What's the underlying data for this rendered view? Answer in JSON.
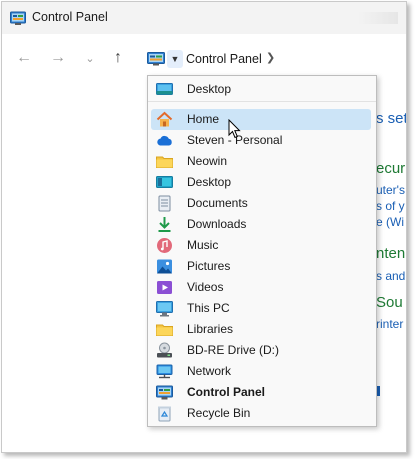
{
  "window": {
    "title": "Control Panel"
  },
  "breadcrumb": {
    "current": "Control Panel"
  },
  "background": {
    "fragments": [
      "s set",
      "ecuri",
      "uter's",
      "s of y",
      "e (Wi",
      "nten",
      "s and",
      "Sou",
      "rinter"
    ]
  },
  "menu": {
    "items": [
      {
        "label": "Desktop",
        "icon": "desktop-icon"
      },
      {
        "label": "Home",
        "icon": "home-icon"
      },
      {
        "label": "Steven - Personal",
        "icon": "cloud-icon"
      },
      {
        "label": "Neowin",
        "icon": "folder-icon"
      },
      {
        "label": "Desktop",
        "icon": "desktop-icon"
      },
      {
        "label": "Documents",
        "icon": "documents-icon"
      },
      {
        "label": "Downloads",
        "icon": "download-icon"
      },
      {
        "label": "Music",
        "icon": "music-icon"
      },
      {
        "label": "Pictures",
        "icon": "pictures-icon"
      },
      {
        "label": "Videos",
        "icon": "videos-icon"
      },
      {
        "label": "This PC",
        "icon": "computer-icon"
      },
      {
        "label": "Libraries",
        "icon": "folder-icon"
      },
      {
        "label": "BD-RE Drive (D:)",
        "icon": "disc-drive-icon"
      },
      {
        "label": "Network",
        "icon": "network-icon"
      },
      {
        "label": "Control Panel",
        "icon": "control-panel-icon"
      },
      {
        "label": "Recycle Bin",
        "icon": "recycle-bin-icon"
      }
    ],
    "hovered": "Home",
    "current": "Control Panel"
  },
  "colors": {
    "accent": "#1a5fb4",
    "hover": "#cce4f7",
    "category_green": "#1e7a34"
  }
}
